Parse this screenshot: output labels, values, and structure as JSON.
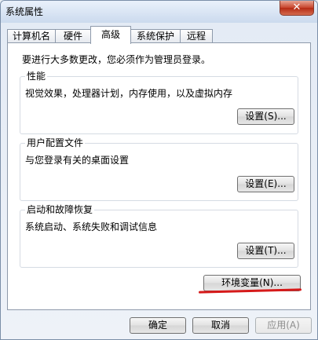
{
  "window": {
    "title": "系统属性",
    "close_glyph": "✕"
  },
  "tabs": [
    {
      "label": "计算机名",
      "active": false
    },
    {
      "label": "硬件",
      "active": false
    },
    {
      "label": "高级",
      "active": true
    },
    {
      "label": "系统保护",
      "active": false
    },
    {
      "label": "远程",
      "active": false
    }
  ],
  "panel": {
    "intro": "要进行大多数更改，您必须作为管理员登录。",
    "performance": {
      "legend": "性能",
      "description": "视觉效果，处理器计划，内存使用，以及虚拟内存",
      "button": "设置(S)..."
    },
    "user_profiles": {
      "legend": "用户配置文件",
      "description": "与您登录有关的桌面设置",
      "button": "设置(E)..."
    },
    "startup_recovery": {
      "legend": "启动和故障恢复",
      "description": "系统启动、系统失败和调试信息",
      "button": "设置(T)..."
    },
    "env_button": "环境变量(N)..."
  },
  "footer": {
    "ok": "确定",
    "cancel": "取消",
    "apply": "应用(A)"
  },
  "colors": {
    "annotation_underline": "#d61a1a"
  }
}
